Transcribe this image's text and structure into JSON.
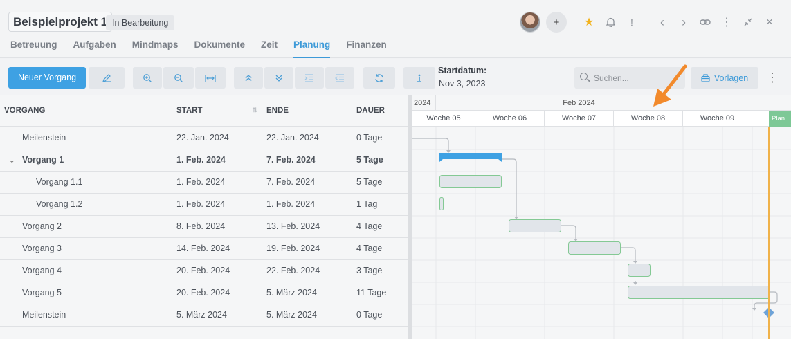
{
  "project": {
    "title": "Beispielprojekt 1",
    "status": "In Bearbeitung"
  },
  "header_icons": {
    "plus": "+",
    "star": "★",
    "bell": "bell-icon",
    "alert": "!",
    "prev": "‹",
    "next": "›",
    "link": "link-icon",
    "more": "⋮",
    "collapse": "collapse-icon",
    "close": "×"
  },
  "tabs": [
    {
      "label": "Betreuung"
    },
    {
      "label": "Aufgaben"
    },
    {
      "label": "Mindmaps"
    },
    {
      "label": "Dokumente"
    },
    {
      "label": "Zeit"
    },
    {
      "label": "Planung"
    },
    {
      "label": "Finanzen"
    }
  ],
  "active_tab": "Planung",
  "toolbar": {
    "new_task": "Neuer Vorgang",
    "start_label": "Startdatum:",
    "start_value": "Nov 3, 2023",
    "search_placeholder": "Suchen...",
    "templates": "Vorlagen"
  },
  "grid": {
    "columns": [
      "VORGANG",
      "START",
      "ENDE",
      "DAUER"
    ],
    "rows": [
      {
        "name": "Meilenstein",
        "start": "22. Jan. 2024",
        "end": "22. Jan. 2024",
        "duration": "0 Tage"
      },
      {
        "name": "Vorgang 1",
        "start": "1. Feb. 2024",
        "end": "7. Feb. 2024",
        "duration": "5 Tage"
      },
      {
        "name": "Vorgang 1.1",
        "start": "1. Feb. 2024",
        "end": "7. Feb. 2024",
        "duration": "5 Tage"
      },
      {
        "name": "Vorgang 1.2",
        "start": "1. Feb. 2024",
        "end": "1. Feb. 2024",
        "duration": "1 Tag"
      },
      {
        "name": "Vorgang 2",
        "start": "8. Feb. 2024",
        "end": "13. Feb. 2024",
        "duration": "4 Tage"
      },
      {
        "name": "Vorgang 3",
        "start": "14. Feb. 2024",
        "end": "19. Feb. 2024",
        "duration": "4 Tage"
      },
      {
        "name": "Vorgang 4",
        "start": "20. Feb. 2024",
        "end": "22. Feb. 2024",
        "duration": "3 Tage"
      },
      {
        "name": "Vorgang 5",
        "start": "20. Feb. 2024",
        "end": "5. März 2024",
        "duration": "11 Tage"
      },
      {
        "name": "Meilenstein",
        "start": "5. März 2024",
        "end": "5. März 2024",
        "duration": "0 Tage"
      }
    ]
  },
  "timeline": {
    "years": [
      "2024"
    ],
    "months": [
      "Feb 2024"
    ],
    "weeks": [
      "Woche 05",
      "Woche 06",
      "Woche 07",
      "Woche 08",
      "Woche 09"
    ],
    "today_label": "Plan"
  },
  "colors": {
    "accent": "#3ea1e3",
    "task_fill": "#e1e5ea",
    "task_border": "#84c994",
    "summary": "#3ea1e3",
    "today": "#f0b24a",
    "arrow": "#f28a2c",
    "milestone": "#6ea3d8"
  }
}
